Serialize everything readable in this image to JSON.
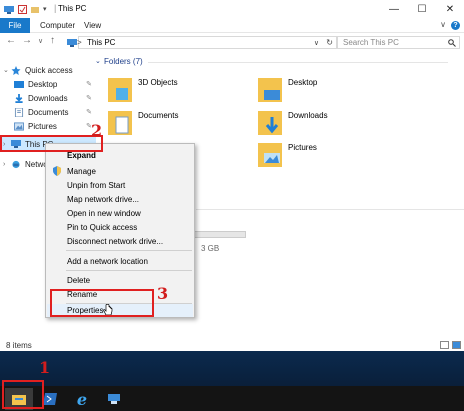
{
  "window": {
    "title": "This PC",
    "minimize": "—",
    "maximize": "☐",
    "close": "✕"
  },
  "ribbon": {
    "tabs": [
      "File",
      "Computer",
      "View"
    ],
    "help": "?",
    "expand": "∨"
  },
  "address": {
    "path_root": "This PC",
    "separator": ">",
    "dropdown": "∨",
    "refresh": "↻",
    "search_placeholder": "Search This PC",
    "back": "←",
    "forward": "→",
    "recent": "∨",
    "up": "↑"
  },
  "navpane": {
    "quick_access": "Quick access",
    "items": [
      {
        "label": "Desktop",
        "icon": "desktop-icon"
      },
      {
        "label": "Downloads",
        "icon": "downloads-icon"
      },
      {
        "label": "Documents",
        "icon": "documents-icon"
      },
      {
        "label": "Pictures",
        "icon": "pictures-icon"
      }
    ],
    "this_pc": "This PC",
    "network": "Netwo"
  },
  "content": {
    "folders_header": "Folders (7)",
    "folders": [
      {
        "label": "3D Objects"
      },
      {
        "label": "Desktop"
      },
      {
        "label": "Documents"
      },
      {
        "label": "Downloads"
      },
      {
        "label": "Pictures"
      }
    ],
    "drive_size": "3 GB"
  },
  "context_menu": {
    "items": [
      "Expand",
      "Manage",
      "Unpin from Start",
      "Map network drive...",
      "Open in new window",
      "Pin to Quick access",
      "Disconnect network drive...",
      "Add a network location",
      "Delete",
      "Rename",
      "Properties"
    ]
  },
  "status": {
    "items_count": "8 items"
  },
  "annotations": {
    "step1": "1",
    "step2": "2",
    "step3": "3"
  },
  "colors": {
    "accent": "#1979ca",
    "annotation_red": "#e02020",
    "folder_yellow": "#f3c34d"
  }
}
